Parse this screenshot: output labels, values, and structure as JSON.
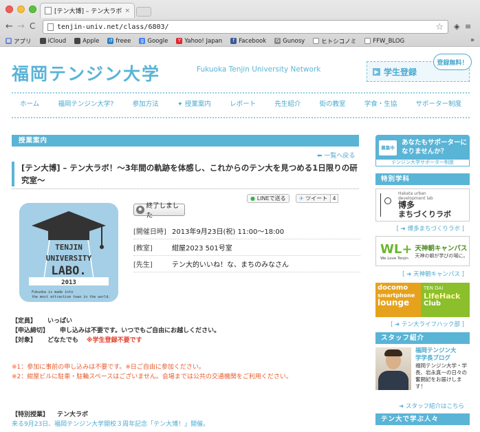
{
  "browser": {
    "tab_title": "[テン大博] – テン大ラボ！〜",
    "tab_close": "×",
    "url": "tenjin-univ.net/class/6803/",
    "back": "←",
    "forward": "→",
    "reload": "C",
    "star": "☆",
    "bookmarks": [
      "アプリ",
      "iCloud",
      "Apple",
      "freee",
      "Google",
      "Yahoo! Japan",
      "Facebook",
      "Gunosy",
      "ヒトシコノミ",
      "FFW_BLOG"
    ],
    "bookmarks_more": "»"
  },
  "site": {
    "logo_jp": "福岡テンジン大学",
    "logo_en": "Fukuoka Tenjin University Network",
    "register_label": "学生登録",
    "register_badge": "登録無料！"
  },
  "nav": [
    "ホーム",
    "福岡テンジン大学?",
    "参加方法",
    "授業案内",
    "レポート",
    "先生紹介",
    "街の教室",
    "学食・生協",
    "サポーター制度"
  ],
  "main": {
    "section_label": "授業案内",
    "back_link": "一覧へ戻る",
    "title": "[テン大博] – テン大ラボ！〜3年間の軌跡を体感し、これからのテン大を見つめる1日限りの研究室〜",
    "share_line": "LINEで送る",
    "share_tweet": "ツイート",
    "share_count": "4",
    "status": "終了しました",
    "image": {
      "line1": "TENJIN",
      "line2": "UNIVERSITY",
      "line3": "LABO.",
      "year": "2013",
      "caption1": "Fukuoka is made into",
      "caption2": "the most attractive town in the world."
    },
    "info": [
      {
        "key": "[開催日時]",
        "value": "2013年9月23日(祝) 11:00～18:00"
      },
      {
        "key": "[教室]",
        "value": "紺屋2023 501号室"
      },
      {
        "key": "[先生]",
        "value": "テン大的いいね！な、まちのみなさん"
      }
    ],
    "details": {
      "capacity_key": "【定員】",
      "capacity": "いっぱい",
      "apply_key": "【申込締切】",
      "apply": "申し込みは不要です。いつでもご自由にお越しください。",
      "target_key": "【対象】",
      "target": "どなたでも",
      "target_note": "※学生登録不要です"
    },
    "notes": [
      "※1：参加に事前の申し込みは不要です。※日ご自由に参加ください。",
      "※2：紺屋ビルに駐車・駐輪スペースはございません。会場までは公共の交通機関をご利用ください。"
    ],
    "special_key": "【特別授業】",
    "special_value": "テン大ラボ",
    "special_text": "来る9月23日、福岡テンジン大学開校３周年記念「テン大博！」開催。"
  },
  "sidebar": {
    "supporter_icon": "募集中",
    "supporter_text1": "あなたもサポーターに",
    "supporter_text2": "なりませんか？",
    "supporter_sub": "テンジン大学サポーター制度",
    "special_head": "特別学科",
    "hakata_title": "博多",
    "hakata_sub": "まちづくりラボ",
    "hakata_en": "Hakata urban development lab",
    "hakata_link": "博多まちづくりラボ",
    "wl_logo": "WL+",
    "wl_title": "天神朝キャンパス",
    "wl_en": "We Love Tenjin",
    "wl_sub": "天神の朝が学びの場に。",
    "wl_link": "天神朝キャンパス",
    "docomo1": "docomo",
    "docomo2": "smartphone",
    "docomo3": "lounge",
    "lifehack1": "TEN DAI",
    "lifehack2": "LifeHack",
    "lifehack3": "Club",
    "lifehack_link": "テン大ライフハック部",
    "staff_head": "スタッフ紹介",
    "staff_title1": "福岡テンジン大",
    "staff_title2": "学学長ブログ",
    "staff_desc": "福岡テンジン大学・学長、岩永真一の日々の奮闘記をお届けします！",
    "staff_link": "スタッフ紹介はこちら",
    "learn_head": "テン大で学ぶ人々"
  },
  "colors": {
    "accent": "#5ab4d6",
    "red": "#e03d2a",
    "orange": "#e85a2a"
  }
}
